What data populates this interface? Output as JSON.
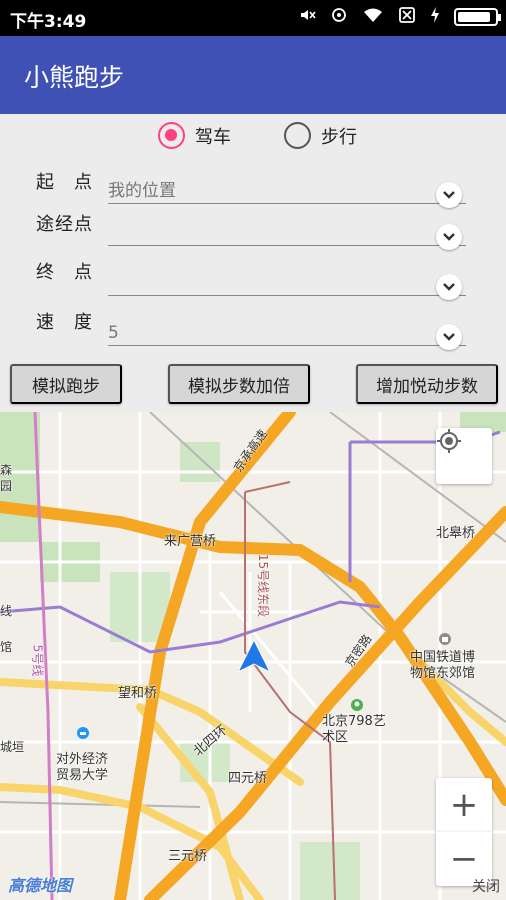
{
  "status_bar": {
    "time": "下午3:49",
    "icons": [
      "mute-icon",
      "signal-icon",
      "wifi-icon",
      "sim-off-icon",
      "charging-icon",
      "battery-icon"
    ],
    "battery_level": 0.9
  },
  "app_bar": {
    "title": "小熊跑步"
  },
  "mode_options": [
    {
      "label": "驾车",
      "checked": true
    },
    {
      "label": "步行",
      "checked": false
    }
  ],
  "form": {
    "start": {
      "label": "起　点",
      "value": "我的位置"
    },
    "waypoint": {
      "label": "途经点",
      "value": ""
    },
    "end": {
      "label": "终　点",
      "value": ""
    },
    "speed": {
      "label": "速　度",
      "value": "5"
    }
  },
  "buttons": {
    "simulate_run": "模拟跑步",
    "double_steps": "模拟步数加倍",
    "add_yuedong_steps": "增加悦动步数"
  },
  "map": {
    "place_labels": {
      "laiguangying_bridge": "来广营桥",
      "beigao_bridge": "北皋桥",
      "wanghe_bridge": "望和桥",
      "sihuan": "北四环",
      "siyuan_bridge": "四元桥",
      "sanyuan_bridge": "三元桥",
      "district_798": "北京798艺\n术区",
      "railway_museum": "中国铁道博\n物馆东郊馆",
      "uibe": "对外经济\n贸易大学",
      "line15_east": "15号线东段",
      "line5": "5号线",
      "jingcheng_exp": "京承高速",
      "jingmi_road": "京密路",
      "olympic_forest": "森\n园",
      "city_edge": "城垣",
      "guan": "馆",
      "xian": "线"
    },
    "logo": "高德地图",
    "close_label": "关闭",
    "zoom_in": "+",
    "zoom_out": "−",
    "accent_color": "#3f51b5",
    "radio_color": "#ff4081",
    "marker_color": "#2176e8"
  }
}
